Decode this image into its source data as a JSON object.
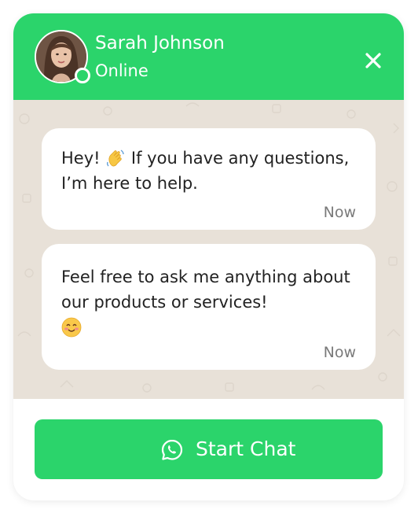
{
  "header": {
    "name": "Sarah Johnson",
    "status": "Online",
    "avatar_icon": "user-avatar-photo",
    "close_icon": "close-icon",
    "background": "#2bd46b"
  },
  "messages": [
    {
      "text_before": "Hey! ",
      "emoji": "waving-hand-emoji",
      "text_after": " If you have any questions, I’m here to help.",
      "time": "Now"
    },
    {
      "text_before": "Feel free to ask me anything about our products or services!",
      "emoji": "smiling-face-emoji",
      "text_after": "",
      "time": "Now"
    }
  ],
  "footer": {
    "button_label": "Start Chat",
    "button_icon": "whatsapp-icon"
  },
  "colors": {
    "accent": "#2bd46b",
    "chat_background": "#e8e1d8",
    "bubble": "#ffffff"
  }
}
